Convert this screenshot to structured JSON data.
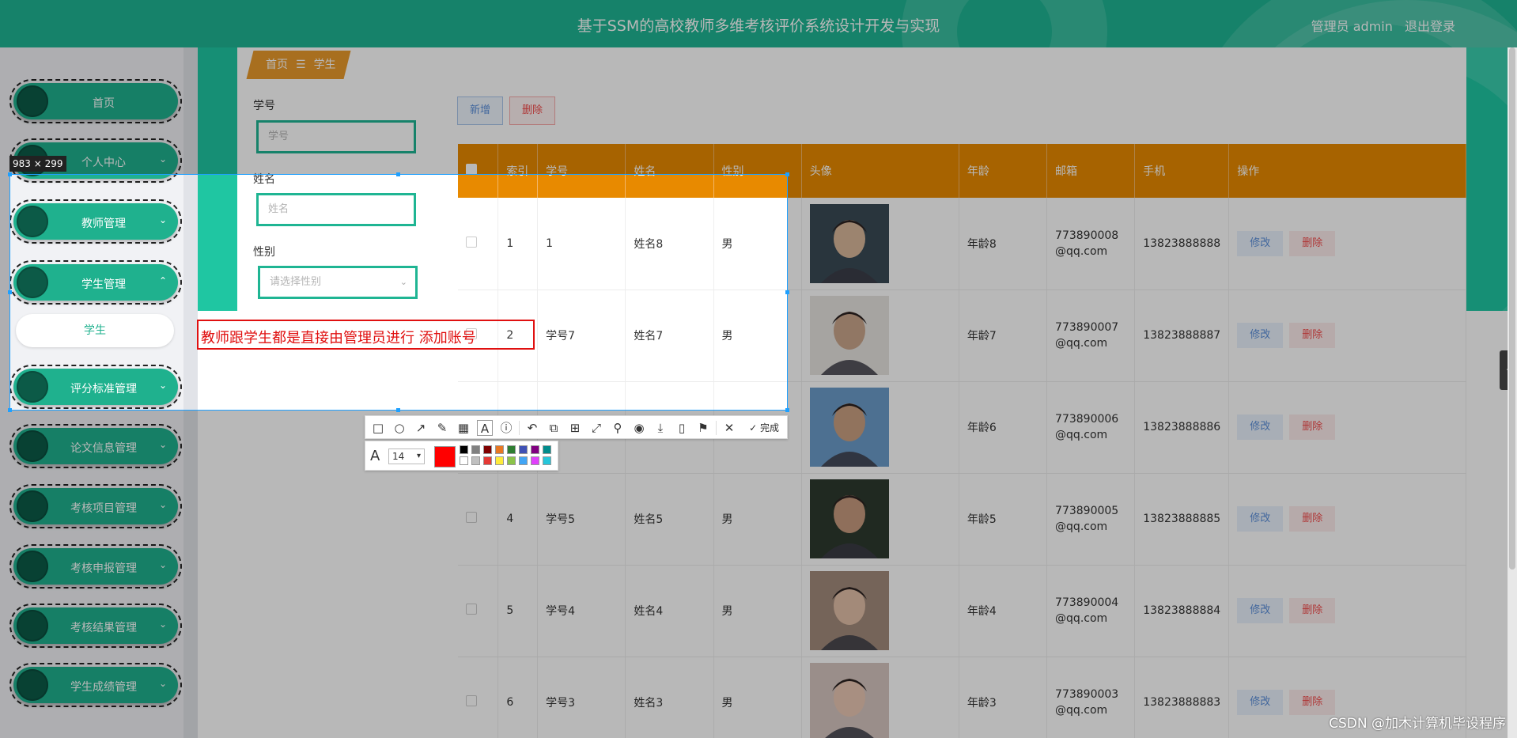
{
  "header": {
    "title": "基于SSM的高校教师多维考核评价系统设计开发与实现",
    "user": "管理员 admin",
    "logout": "退出登录"
  },
  "sidebar": {
    "items": [
      {
        "label": "首页",
        "chevron": ""
      },
      {
        "label": "个人中心",
        "chevron": "⌄"
      },
      {
        "label": "教师管理",
        "chevron": "⌄"
      },
      {
        "label": "学生管理",
        "chevron": "⌃"
      },
      {
        "label": "评分标准管理",
        "chevron": "⌄"
      },
      {
        "label": "论文信息管理",
        "chevron": "⌄"
      },
      {
        "label": "考核项目管理",
        "chevron": "⌄"
      },
      {
        "label": "考核申报管理",
        "chevron": "⌄"
      },
      {
        "label": "考核结果管理",
        "chevron": "⌄"
      },
      {
        "label": "学生成绩管理",
        "chevron": "⌄"
      }
    ],
    "submenu_label": "学生"
  },
  "breadcrumb": {
    "home": "首页",
    "sep": "☰",
    "current": "学生"
  },
  "filters": {
    "student_no_label": "学号",
    "student_no_placeholder": "学号",
    "name_label": "姓名",
    "name_placeholder": "姓名",
    "gender_label": "性别",
    "gender_placeholder": "请选择性别"
  },
  "buttons": {
    "add": "新增",
    "delete": "删除"
  },
  "table": {
    "headers": [
      "索引",
      "学号",
      "姓名",
      "性别",
      "头像",
      "年龄",
      "邮箱",
      "手机",
      "操作"
    ],
    "edit_label": "修改",
    "delete_label": "删除",
    "rows": [
      {
        "index": "1",
        "no": "1",
        "name": "姓名8",
        "gender": "男",
        "age": "年龄8",
        "email": "773890008@qq.com",
        "phone": "13823888888"
      },
      {
        "index": "2",
        "no": "学号7",
        "name": "姓名7",
        "gender": "男",
        "age": "年龄7",
        "email": "773890007@qq.com",
        "phone": "13823888887"
      },
      {
        "index": "",
        "no": "",
        "name": "",
        "gender": "",
        "age": "年龄6",
        "email": "773890006@qq.com",
        "phone": "13823888886"
      },
      {
        "index": "4",
        "no": "学号5",
        "name": "姓名5",
        "gender": "男",
        "age": "年龄5",
        "email": "773890005@qq.com",
        "phone": "13823888885"
      },
      {
        "index": "5",
        "no": "学号4",
        "name": "姓名4",
        "gender": "男",
        "age": "年龄4",
        "email": "773890004@qq.com",
        "phone": "13823888884"
      },
      {
        "index": "6",
        "no": "学号3",
        "name": "姓名3",
        "gender": "男",
        "age": "年龄3",
        "email": "773890003@qq.com",
        "phone": "13823888883"
      }
    ]
  },
  "capture": {
    "size_label": "983 × 299",
    "annotation_text": "教师跟学生都是直接由管理员进行 添加账号",
    "done_label": "完成",
    "font_size": "14",
    "current_color": "#ff0000",
    "palette": [
      "#000000",
      "#808080",
      "#800000",
      "#e87722",
      "#2e7d32",
      "#3f51b5",
      "#800080",
      "#008b8b",
      "#ffffff",
      "#c0c0c0",
      "#e53935",
      "#ffeb3b",
      "#8bc34a",
      "#42a5f5",
      "#e040fb",
      "#26c6da"
    ]
  },
  "watermark": "CSDN @加木计算机毕设程序",
  "colors": {
    "primary": "#1fb593",
    "table_header": "#e88a00",
    "danger": "#f24b4b",
    "selection": "#1ea0ff"
  }
}
